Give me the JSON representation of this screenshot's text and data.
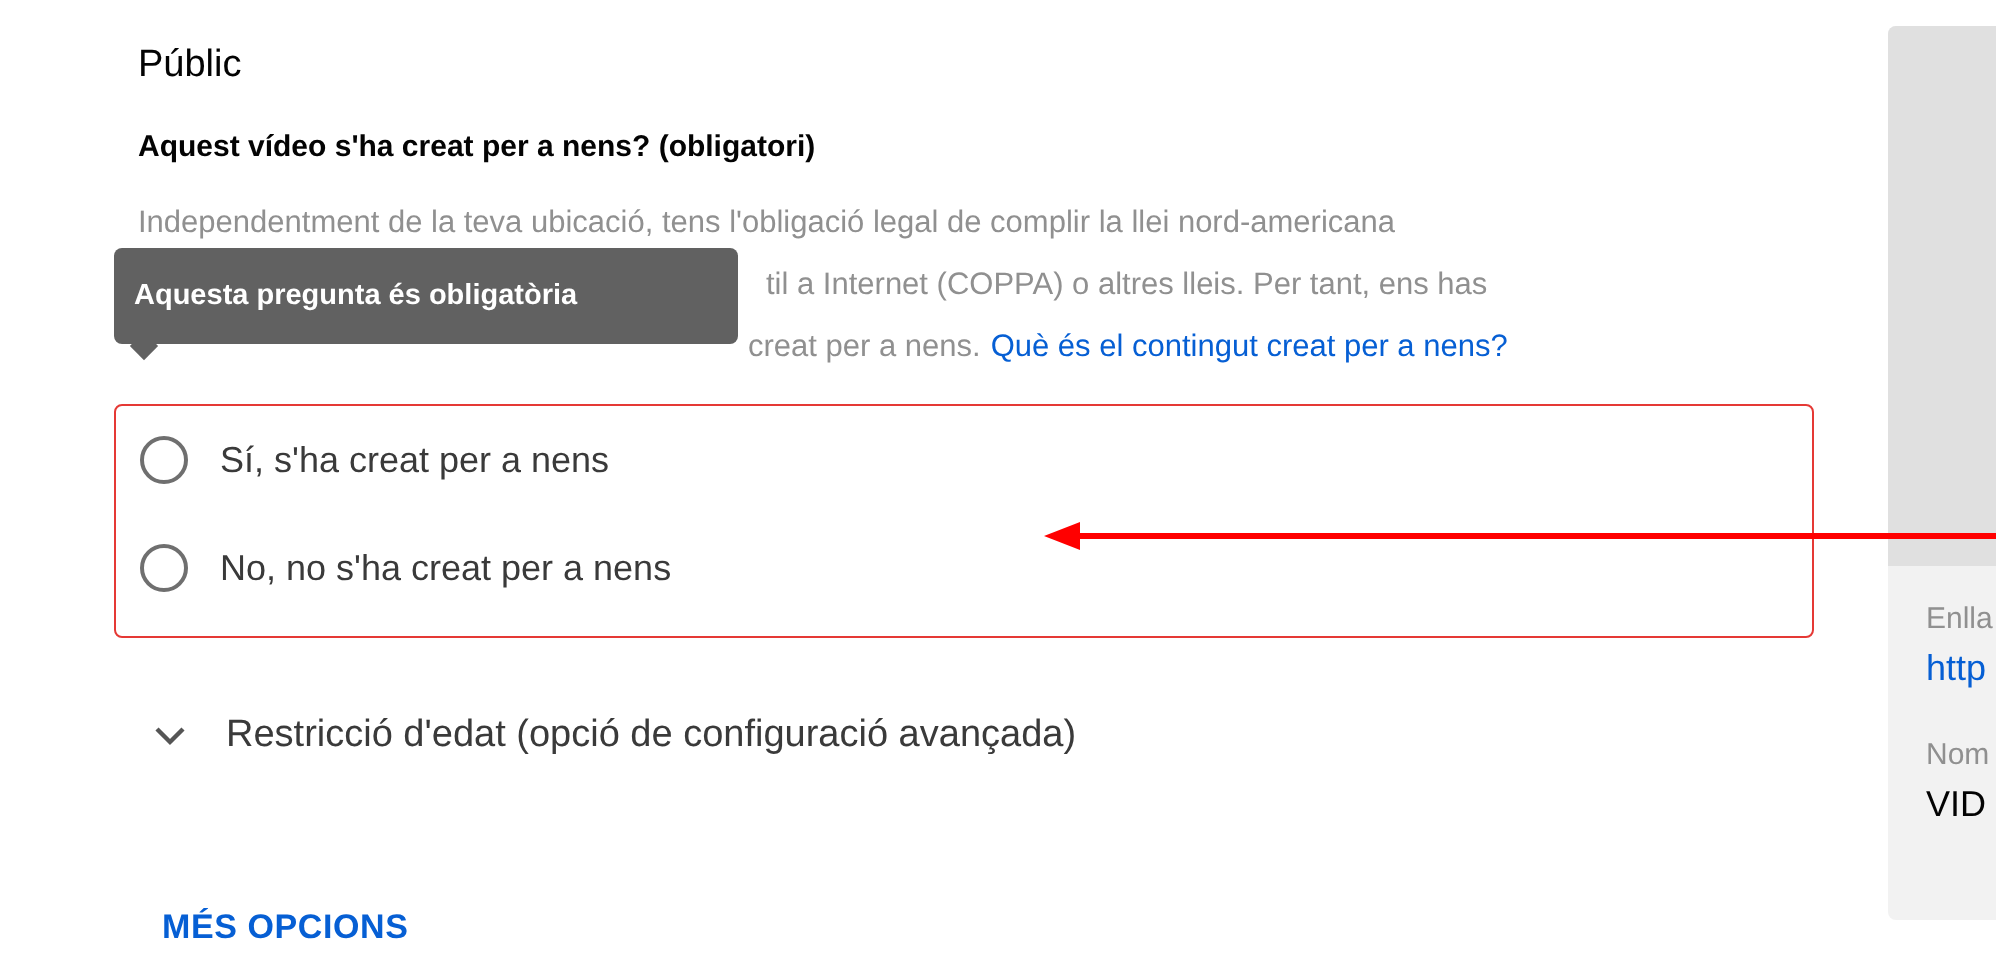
{
  "section_title": "Públic",
  "question": "Aquest vídeo s'ha creat per a nens? (obligatori)",
  "description": {
    "line_1": "Independentment de la teva ubicació, tens l'obligació legal de complir la llei nord-americana",
    "line_2": "til a Internet (COPPA) o altres lleis. Per tant, ens has",
    "line_3": "creat per a nens.",
    "link": "Què és el contingut creat per a nens?"
  },
  "tooltip": "Aquesta pregunta és obligatòria",
  "options_error": true,
  "options": [
    {
      "label": "Sí, s'ha creat per a nens",
      "selected": false
    },
    {
      "label": "No, no s'ha creat per a nens",
      "selected": false
    }
  ],
  "age_restriction": {
    "label": "Restricció d'edat (opció de configuració avançada)",
    "expanded": false
  },
  "more_options": "MÉS OPCIONS",
  "side_panel": {
    "link_label": "Enlla",
    "link": "http",
    "name_label": "Nom",
    "name": "VID"
  }
}
